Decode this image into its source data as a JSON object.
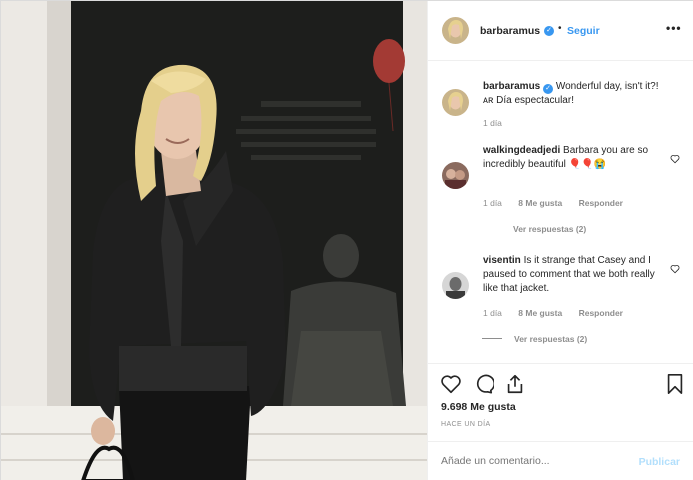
{
  "post": {
    "username": "barbaramus",
    "follow_label": "Seguir",
    "more_label": "•••",
    "dot_separator": "•"
  },
  "comments": [
    {
      "username": "barbaramus",
      "text": "Wonderful day, isn't it?! ᴀʀ Día espectacular!",
      "time": "1 día",
      "verified": true
    },
    {
      "username": "walkingdeadjedi",
      "text": "Barbara you are so incredibly beautiful 🎈🎈😭",
      "time": "1 día",
      "likes": "8 Me gusta",
      "reply": "Responder",
      "view_replies": "Ver respuestas (2)"
    },
    {
      "username": "visentin",
      "text": "Is it strange that Casey and I paused to comment that we both really like that jacket.",
      "time": "1 día",
      "likes": "8 Me gusta",
      "reply": "Responder",
      "view_replies": "Ver respuestas (2)"
    }
  ],
  "footer": {
    "likes": "9.698 Me gusta",
    "posted": "HACE UN DÍA",
    "comment_placeholder": "Añade un comentario...",
    "publish_label": "Publicar"
  },
  "icons": [
    "heart-icon",
    "comment-icon",
    "share-icon",
    "bookmark-icon",
    "more-icon",
    "verified-icon"
  ],
  "colors": {
    "accent": "#3897f0",
    "muted": "#8e8e8e",
    "publish_disabled": "#b2dffc",
    "text": "#262626"
  }
}
